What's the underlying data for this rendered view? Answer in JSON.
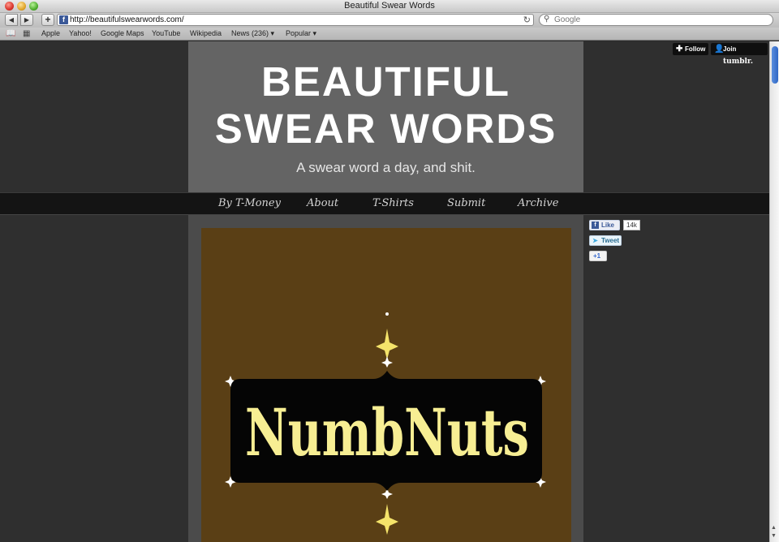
{
  "window": {
    "title": "Beautiful Swear Words"
  },
  "toolbar": {
    "back": "◀",
    "forward": "▶",
    "add": "+",
    "url": "http://beautifulswearwords.com/",
    "search_placeholder": "Google"
  },
  "bookmarks": [
    "Apple",
    "Yahoo!",
    "Google Maps",
    "YouTube",
    "Wikipedia",
    "News (236) ▾",
    "Popular ▾"
  ],
  "header": {
    "title_line1": "BEAUTIFUL",
    "title_line2": "SWEAR WORDS",
    "tagline": "A swear word a day, and shit."
  },
  "nav": [
    "By T-Money",
    "About",
    "T-Shirts",
    "Submit",
    "Archive"
  ],
  "post": {
    "image_text": "NumbNuts"
  },
  "social": {
    "like_label": "Like",
    "like_count": "14k",
    "tweet_label": "Tweet",
    "plus_label": "+1"
  },
  "tumblr": {
    "follow_label": "Follow",
    "join_prefix": "Join",
    "join_brand": "tumblr."
  },
  "colors": {
    "header_bg": "#646464",
    "page_bg": "#2f2f2f",
    "post_bg": "#5a3f15",
    "sign_bg": "#050505",
    "sign_text": "#f7ee93",
    "sparkle": "#f4e36a"
  }
}
